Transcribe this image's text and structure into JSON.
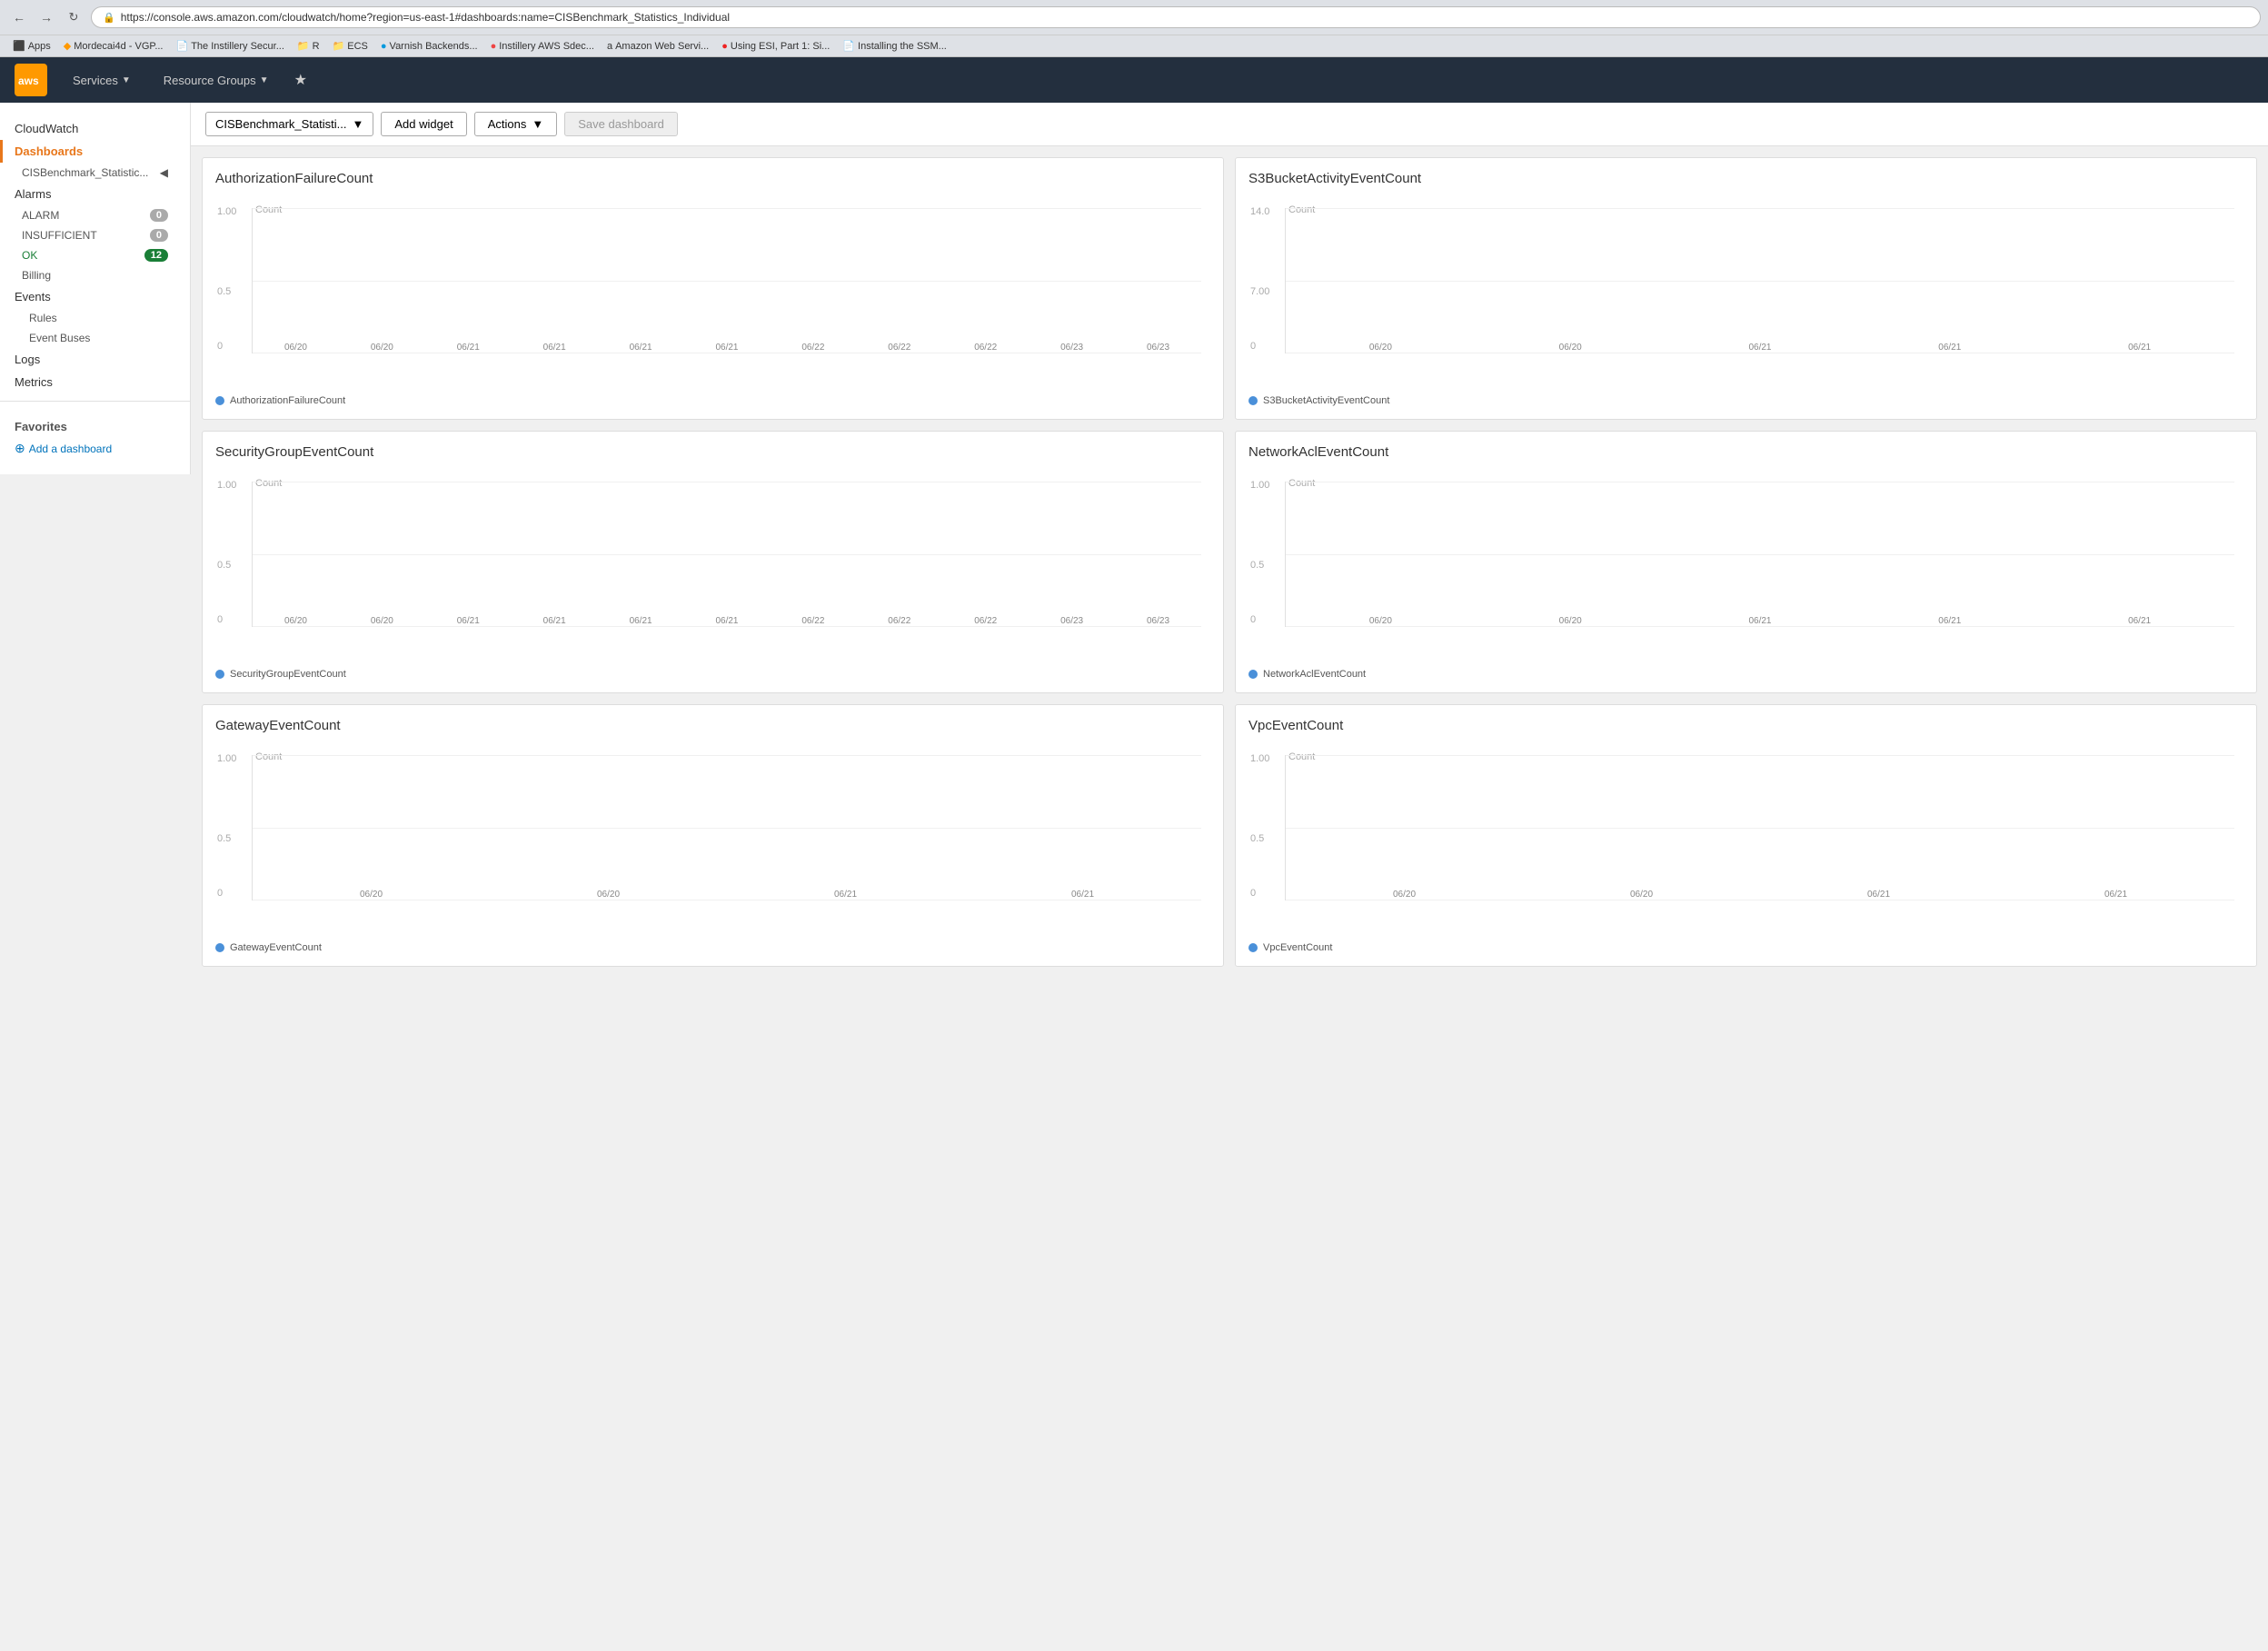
{
  "browser": {
    "url": "https://console.aws.amazon.com/cloudwatch/home?region=us-east-1#dashboards:name=CISBenchmark_Statistics_Individual",
    "bookmarks": [
      {
        "label": "Apps",
        "color": "#4285f4"
      },
      {
        "label": "Mordecai4d - VGP...",
        "color": "#ff9900"
      },
      {
        "label": "The Instillery Secur...",
        "color": "#555"
      },
      {
        "label": "R",
        "color": "#555"
      },
      {
        "label": "ECS",
        "color": "#555"
      },
      {
        "label": "Varnish Backends...",
        "color": "#09d"
      },
      {
        "label": "Instillery AWS Sdec...",
        "color": "#e44"
      },
      {
        "label": "Amazon Web Servi...",
        "color": "#a00"
      },
      {
        "label": "Using ESI, Part 1: Si...",
        "color": "#e22"
      },
      {
        "label": "Installing the SSM...",
        "color": "#aa0"
      }
    ]
  },
  "aws_header": {
    "logo": "aws",
    "nav_items": [
      "Services",
      "Resource Groups"
    ],
    "services_label": "Services",
    "resource_groups_label": "Resource Groups"
  },
  "sidebar": {
    "cloudwatch_label": "CloudWatch",
    "dashboards_label": "Dashboards",
    "dashboard_item": "CISBenchmark_Statistic...",
    "alarms_label": "Alarms",
    "alarm_label": "ALARM",
    "alarm_count": "0",
    "insufficient_label": "INSUFFICIENT",
    "insufficient_count": "0",
    "ok_label": "OK",
    "ok_count": "12",
    "billing_label": "Billing",
    "events_label": "Events",
    "rules_label": "Rules",
    "event_buses_label": "Event Buses",
    "logs_label": "Logs",
    "metrics_label": "Metrics",
    "favorites_label": "Favorites",
    "add_dashboard_label": "Add a dashboard"
  },
  "toolbar": {
    "dashboard_name": "CISBenchmark_Statisti...",
    "add_widget_label": "Add widget",
    "actions_label": "Actions",
    "save_dashboard_label": "Save dashboard"
  },
  "widgets": [
    {
      "id": "w1",
      "title": "AuthorizationFailureCount",
      "y_max": "1.00",
      "y_mid": "0.5",
      "y_min": "0",
      "count_label": "Count",
      "legend": "AuthorizationFailureCount",
      "x_labels": [
        "06/20",
        "06/20",
        "06/21",
        "06/21",
        "06/21",
        "06/21",
        "06/22",
        "06/22",
        "06/22",
        "06/23",
        "06/23"
      ],
      "dot_color": "#4a90d9"
    },
    {
      "id": "w2",
      "title": "S3BucketActivityEventCount",
      "y_max": "14.0",
      "y_mid": "7.00",
      "y_min": "0",
      "count_label": "Count",
      "legend": "S3BucketActivityEventCount",
      "x_labels": [
        "06/20",
        "06/20",
        "06/21",
        "06/21",
        "06/21"
      ],
      "dot_color": "#4a90d9"
    },
    {
      "id": "w3",
      "title": "SecurityGroupEventCount",
      "y_max": "1.00",
      "y_mid": "0.5",
      "y_min": "0",
      "count_label": "Count",
      "legend": "SecurityGroupEventCount",
      "x_labels": [
        "06/20",
        "06/20",
        "06/21",
        "06/21",
        "06/21",
        "06/21",
        "06/22",
        "06/22",
        "06/22",
        "06/23",
        "06/23"
      ],
      "dot_color": "#4a90d9"
    },
    {
      "id": "w4",
      "title": "NetworkAclEventCount",
      "y_max": "1.00",
      "y_mid": "0.5",
      "y_min": "0",
      "count_label": "Count",
      "legend": "NetworkAclEventCount",
      "x_labels": [
        "06/20",
        "06/20",
        "06/21",
        "06/21",
        "06/21"
      ],
      "dot_color": "#4a90d9"
    },
    {
      "id": "w5",
      "title": "GatewayEventCount",
      "y_max": "1.00",
      "y_mid": "0.5",
      "y_min": "0",
      "count_label": "Count",
      "legend": "GatewayEventCount",
      "x_labels": [
        "06/20",
        "06/20",
        "06/21",
        "06/21"
      ],
      "dot_color": "#4a90d9"
    },
    {
      "id": "w6",
      "title": "VpcEventCount",
      "y_max": "1.00",
      "y_mid": "0.5",
      "y_min": "0",
      "count_label": "Count",
      "legend": "VpcEventCount",
      "x_labels": [
        "06/20",
        "06/20",
        "06/21",
        "06/21"
      ],
      "dot_color": "#4a90d9"
    }
  ]
}
